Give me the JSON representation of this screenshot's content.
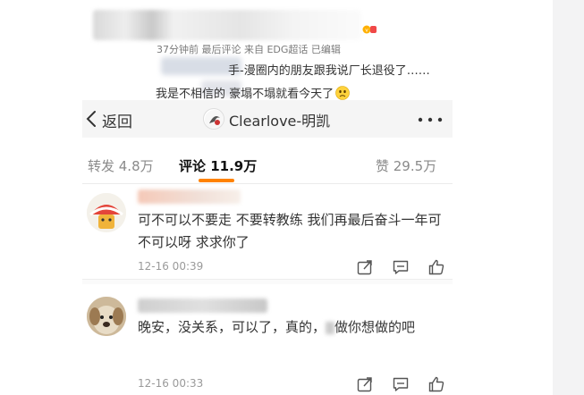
{
  "post": {
    "meta": "37分钟前 最后评论 来自 EDG超话  已编辑",
    "line1": "手-漫圈内的朋友跟我说厂长退役了……",
    "line2": "我是不相信的 豪塌不塌就看今天了",
    "line2_emoji": "sad-face-icon"
  },
  "screenshot": {
    "back_label": "返回",
    "user_title": "Clearlove-明凯",
    "tabs": {
      "repost": "转发 4.8万",
      "comment": "评论 11.9万",
      "like": "赞 29.5万"
    },
    "accent_color": "#ff8200",
    "comments": [
      {
        "text": "可不可以不要走 不要转教练 我们再最后奋斗一年可不可以呀 求求你了",
        "time": "12-16 00:39"
      },
      {
        "text_a": "晚安，没关系，可以了，真的，",
        "text_b": "做你想做的吧",
        "time": "12-16 00:33"
      }
    ]
  }
}
